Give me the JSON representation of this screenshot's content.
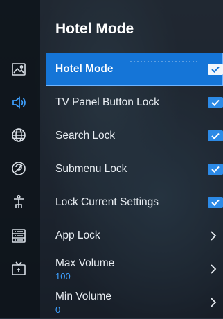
{
  "panel": {
    "title": "Hotel Mode"
  },
  "colors": {
    "accent": "#1575d7",
    "value_text": "#3ea0ff",
    "toggle_on": "#2c8ae6"
  },
  "sidebar": {
    "icons": [
      "picture-icon",
      "sound-icon",
      "network-icon",
      "support-icon",
      "accessibility-icon",
      "general-icon",
      "tv-icon"
    ],
    "active": "sound-icon"
  },
  "menu": {
    "items": [
      {
        "label": "Hotel Mode",
        "control": "checkbox",
        "checked": true,
        "selected": true
      },
      {
        "label": "TV Panel Button Lock",
        "control": "checkbox",
        "checked": true
      },
      {
        "label": "Search Lock",
        "control": "checkbox",
        "checked": true
      },
      {
        "label": "Submenu Lock",
        "control": "checkbox",
        "checked": true
      },
      {
        "label": "Lock Current Settings",
        "control": "checkbox",
        "checked": true
      },
      {
        "label": "App Lock",
        "control": "chevron"
      },
      {
        "label": "Max Volume",
        "value": "100",
        "control": "chevron"
      },
      {
        "label": "Min Volume",
        "value": "0",
        "control": "chevron"
      }
    ]
  }
}
